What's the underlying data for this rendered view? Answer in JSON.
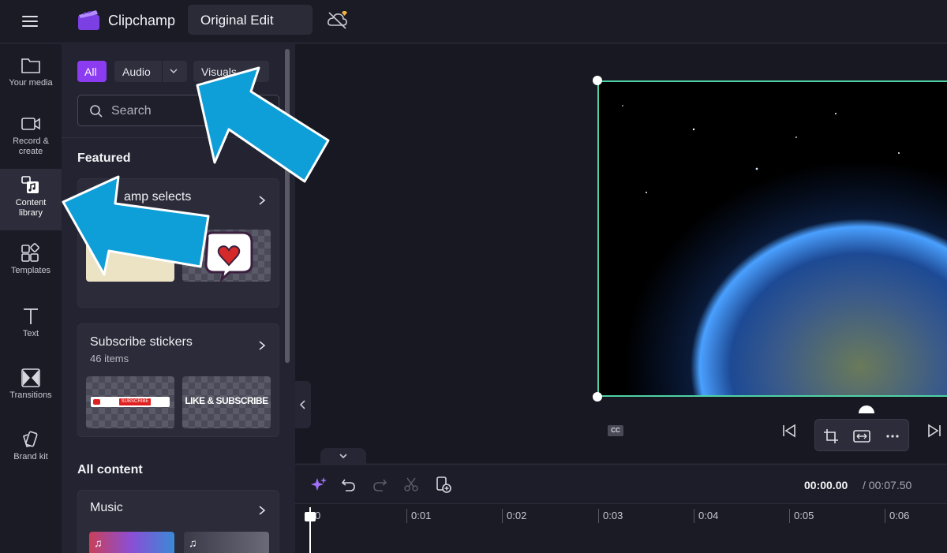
{
  "header": {
    "app_name": "Clipchamp",
    "project_title": "Original Edit"
  },
  "sidebar": {
    "items": [
      {
        "label": "Your media",
        "icon": "folder-icon"
      },
      {
        "label": "Record &\ncreate",
        "icon": "video-camera-icon"
      },
      {
        "label": "Content\nlibrary",
        "icon": "content-library-icon",
        "active": true
      },
      {
        "label": "Templates",
        "icon": "templates-icon"
      },
      {
        "label": "Text",
        "icon": "text-icon"
      },
      {
        "label": "Transitions",
        "icon": "transitions-icon"
      },
      {
        "label": "Brand kit",
        "icon": "brand-kit-icon"
      }
    ]
  },
  "library": {
    "filters": {
      "all": "All",
      "audio": "Audio",
      "visuals": "Visuals"
    },
    "search_placeholder": "Search",
    "featured_title": "Featured",
    "cards": [
      {
        "title": "Clipchamp selects",
        "visible_title": "amp selects"
      },
      {
        "title": "Subscribe stickers",
        "subtitle": "46 items",
        "thumb_text_1": "SUBSCRIBE",
        "thumb_text_2": "LIKE & SUBSCRIBE"
      }
    ],
    "all_content_title": "All content",
    "music_card_title": "Music"
  },
  "preview": {
    "cc_label": "CC"
  },
  "timeline": {
    "current_time": "00:00.00",
    "total_time": "/ 00:07.50",
    "ticks": [
      "0",
      "0:01",
      "0:02",
      "0:03",
      "0:04",
      "0:05",
      "0:06"
    ]
  },
  "colors": {
    "accent_purple": "#8b3bf0",
    "selection_green": "#4fd1a5",
    "annotation_arrow": "#0f9fd8"
  }
}
